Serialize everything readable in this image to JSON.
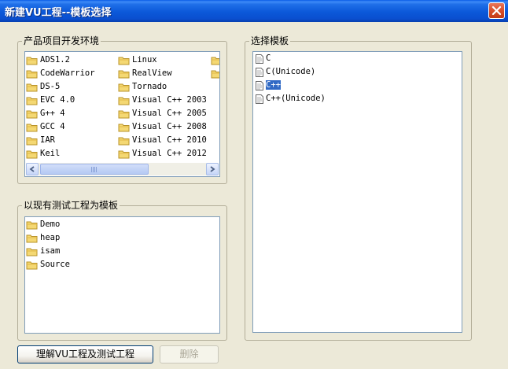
{
  "window": {
    "title": "新建VU工程--模板选择"
  },
  "env_group": {
    "label": "产品项目开发环境",
    "columns": [
      [
        "ADS1.2",
        "CodeWarrior",
        "DS-5",
        "EVC 4.0",
        "G++ 4",
        "GCC 4",
        "IAR",
        "Keil"
      ],
      [
        "Linux",
        "RealView",
        "Tornado",
        "Visual C++ 2003",
        "Visual C++ 2005",
        "Visual C++ 2008",
        "Visual C++ 2010",
        "Visual C++ 2012"
      ]
    ]
  },
  "existing_group": {
    "label": "以现有测试工程为模板",
    "items": [
      "Demo",
      "heap",
      "isam",
      "Source"
    ]
  },
  "template_group": {
    "label": "选择模板",
    "items": [
      "C",
      "C(Unicode)",
      "C++",
      "C++(Unicode)"
    ],
    "selected": "C++"
  },
  "buttons": {
    "understand": "理解VU工程及测试工程",
    "delete": "删除"
  },
  "colors": {
    "selection": "#316ac5",
    "titlebar": "#0b58d9",
    "close": "#d94f2b"
  }
}
